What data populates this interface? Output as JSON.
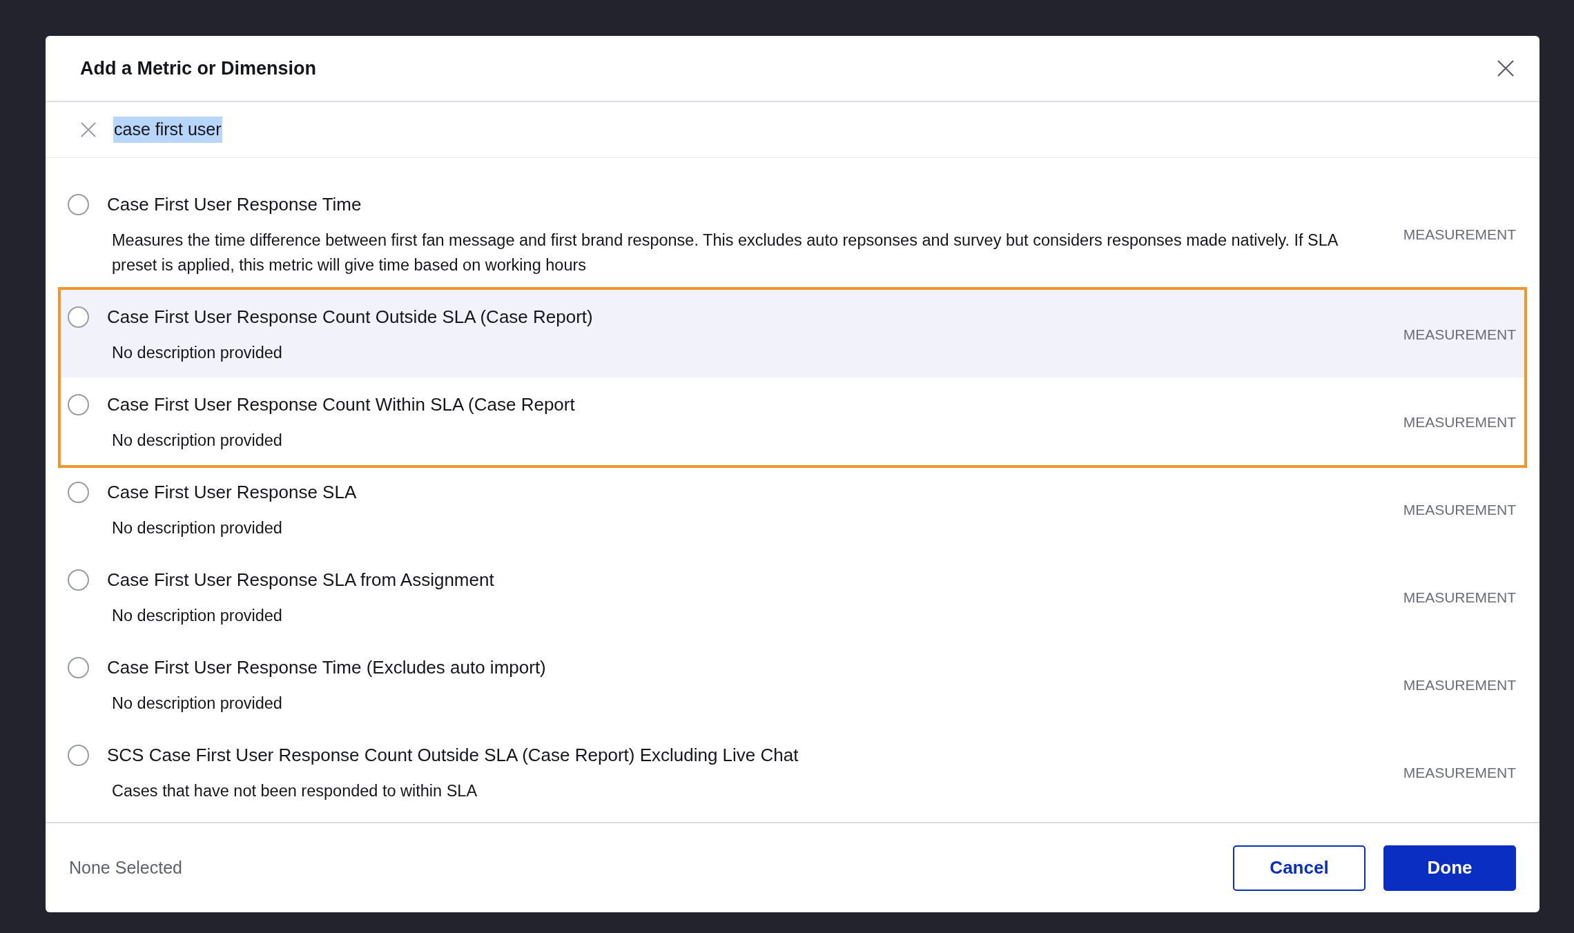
{
  "dialog": {
    "title": "Add a Metric or Dimension"
  },
  "search": {
    "value": "case first user",
    "text_selected": true
  },
  "items": [
    {
      "title": "Case First User Response Time",
      "description": "Measures the time difference between first fan message and first brand response. This excludes auto repsonses and survey but considers responses made natively. If SLA preset is applied, this metric will give time based on working hours",
      "type": "MEASUREMENT",
      "selected": false,
      "hovered": false,
      "outlined": false
    },
    {
      "title": "Case First User Response Count Outside SLA (Case Report)",
      "description": "No description provided",
      "type": "MEASUREMENT",
      "selected": false,
      "hovered": true,
      "outlined": true
    },
    {
      "title": "Case First User Response Count Within SLA (Case Report",
      "description": "No description provided",
      "type": "MEASUREMENT",
      "selected": false,
      "hovered": false,
      "outlined": true
    },
    {
      "title": "Case First User Response SLA",
      "description": "No description provided",
      "type": "MEASUREMENT",
      "selected": false,
      "hovered": false,
      "outlined": false
    },
    {
      "title": "Case First User Response SLA from Assignment",
      "description": "No description provided",
      "type": "MEASUREMENT",
      "selected": false,
      "hovered": false,
      "outlined": false
    },
    {
      "title": "Case First User Response Time (Excludes auto import)",
      "description": "No description provided",
      "type": "MEASUREMENT",
      "selected": false,
      "hovered": false,
      "outlined": false
    },
    {
      "title": "SCS Case First User Response Count Outside SLA (Case Report) Excluding Live Chat",
      "description": "Cases that have not been responded to within SLA",
      "type": "MEASUREMENT",
      "selected": false,
      "hovered": false,
      "outlined": false
    }
  ],
  "footer": {
    "status": "None Selected",
    "buttons": [
      {
        "label": "Cancel",
        "kind": "secondary"
      },
      {
        "label": "Done",
        "kind": "primary"
      }
    ]
  }
}
